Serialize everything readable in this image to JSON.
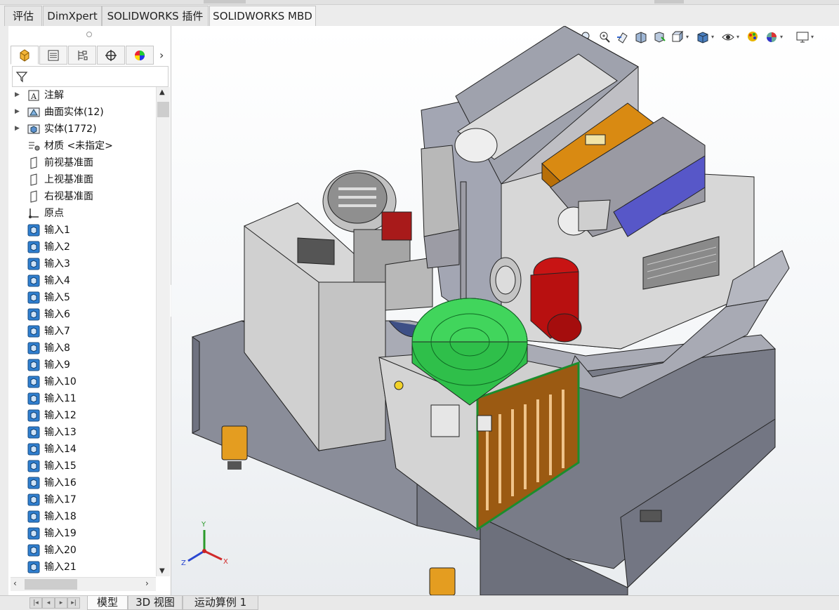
{
  "command_tabs": [
    {
      "label": "评估",
      "active": false
    },
    {
      "label": "DimXpert",
      "active": false
    },
    {
      "label": "SOLIDWORKS 插件",
      "active": false
    },
    {
      "label": "SOLIDWORKS MBD",
      "active": true
    }
  ],
  "heads_up_icons": [
    "zoom-to-fit-icon",
    "zoom-to-area-icon",
    "previous-view-icon",
    "section-view-icon",
    "dynamic-annotation-icon",
    "view-orientation-icon",
    "display-style-icon",
    "hide-show-items-icon",
    "edit-appearance-icon",
    "apply-scene-icon",
    "view-settings-icon"
  ],
  "feature_manager": {
    "tabs": [
      "feature-manager-icon",
      "property-manager-icon",
      "configuration-manager-icon",
      "dimxpert-manager-icon",
      "display-manager-icon"
    ],
    "filter_icon": "filter-icon",
    "tree": [
      {
        "label": "注解",
        "icon": "annotations-icon",
        "expandable": true
      },
      {
        "label": "曲面实体(12)",
        "icon": "surface-bodies-icon",
        "expandable": true
      },
      {
        "label": "实体(1772)",
        "icon": "solid-bodies-icon",
        "expandable": true
      },
      {
        "label": "材质 <未指定>",
        "icon": "material-icon",
        "expandable": false
      },
      {
        "label": "前视基准面",
        "icon": "plane-icon",
        "expandable": false
      },
      {
        "label": "上视基准面",
        "icon": "plane-icon",
        "expandable": false
      },
      {
        "label": "右视基准面",
        "icon": "plane-icon",
        "expandable": false
      },
      {
        "label": "原点",
        "icon": "origin-icon",
        "expandable": false
      },
      {
        "label": "输入1",
        "icon": "imported-body-icon",
        "expandable": false
      },
      {
        "label": "输入2",
        "icon": "imported-body-icon",
        "expandable": false
      },
      {
        "label": "输入3",
        "icon": "imported-body-icon",
        "expandable": false
      },
      {
        "label": "输入4",
        "icon": "imported-body-icon",
        "expandable": false
      },
      {
        "label": "输入5",
        "icon": "imported-body-icon",
        "expandable": false
      },
      {
        "label": "输入6",
        "icon": "imported-body-icon",
        "expandable": false
      },
      {
        "label": "输入7",
        "icon": "imported-body-icon",
        "expandable": false
      },
      {
        "label": "输入8",
        "icon": "imported-body-icon",
        "expandable": false
      },
      {
        "label": "输入9",
        "icon": "imported-body-icon",
        "expandable": false
      },
      {
        "label": "输入10",
        "icon": "imported-body-icon",
        "expandable": false
      },
      {
        "label": "输入11",
        "icon": "imported-body-icon",
        "expandable": false
      },
      {
        "label": "输入12",
        "icon": "imported-body-icon",
        "expandable": false
      },
      {
        "label": "输入13",
        "icon": "imported-body-icon",
        "expandable": false
      },
      {
        "label": "输入14",
        "icon": "imported-body-icon",
        "expandable": false
      },
      {
        "label": "输入15",
        "icon": "imported-body-icon",
        "expandable": false
      },
      {
        "label": "输入16",
        "icon": "imported-body-icon",
        "expandable": false
      },
      {
        "label": "输入17",
        "icon": "imported-body-icon",
        "expandable": false
      },
      {
        "label": "输入18",
        "icon": "imported-body-icon",
        "expandable": false
      },
      {
        "label": "输入19",
        "icon": "imported-body-icon",
        "expandable": false
      },
      {
        "label": "输入20",
        "icon": "imported-body-icon",
        "expandable": false
      },
      {
        "label": "输入21",
        "icon": "imported-body-icon",
        "expandable": false
      }
    ]
  },
  "triad": {
    "x": "X",
    "y": "Y",
    "z": "Z"
  },
  "bottom_tabs": [
    {
      "label": "模型",
      "active": true
    },
    {
      "label": "3D 视图",
      "active": false
    },
    {
      "label": "运动算例 1",
      "active": false
    }
  ],
  "colors": {
    "body_gray": "#8c8f9b",
    "panel_light": "#d6d6d6",
    "green_part": "#3fd35a",
    "orange_part": "#d98a12",
    "red_motor": "#c81414",
    "blue_scraper": "#5757c8",
    "brown_grill": "#9b5a12"
  }
}
